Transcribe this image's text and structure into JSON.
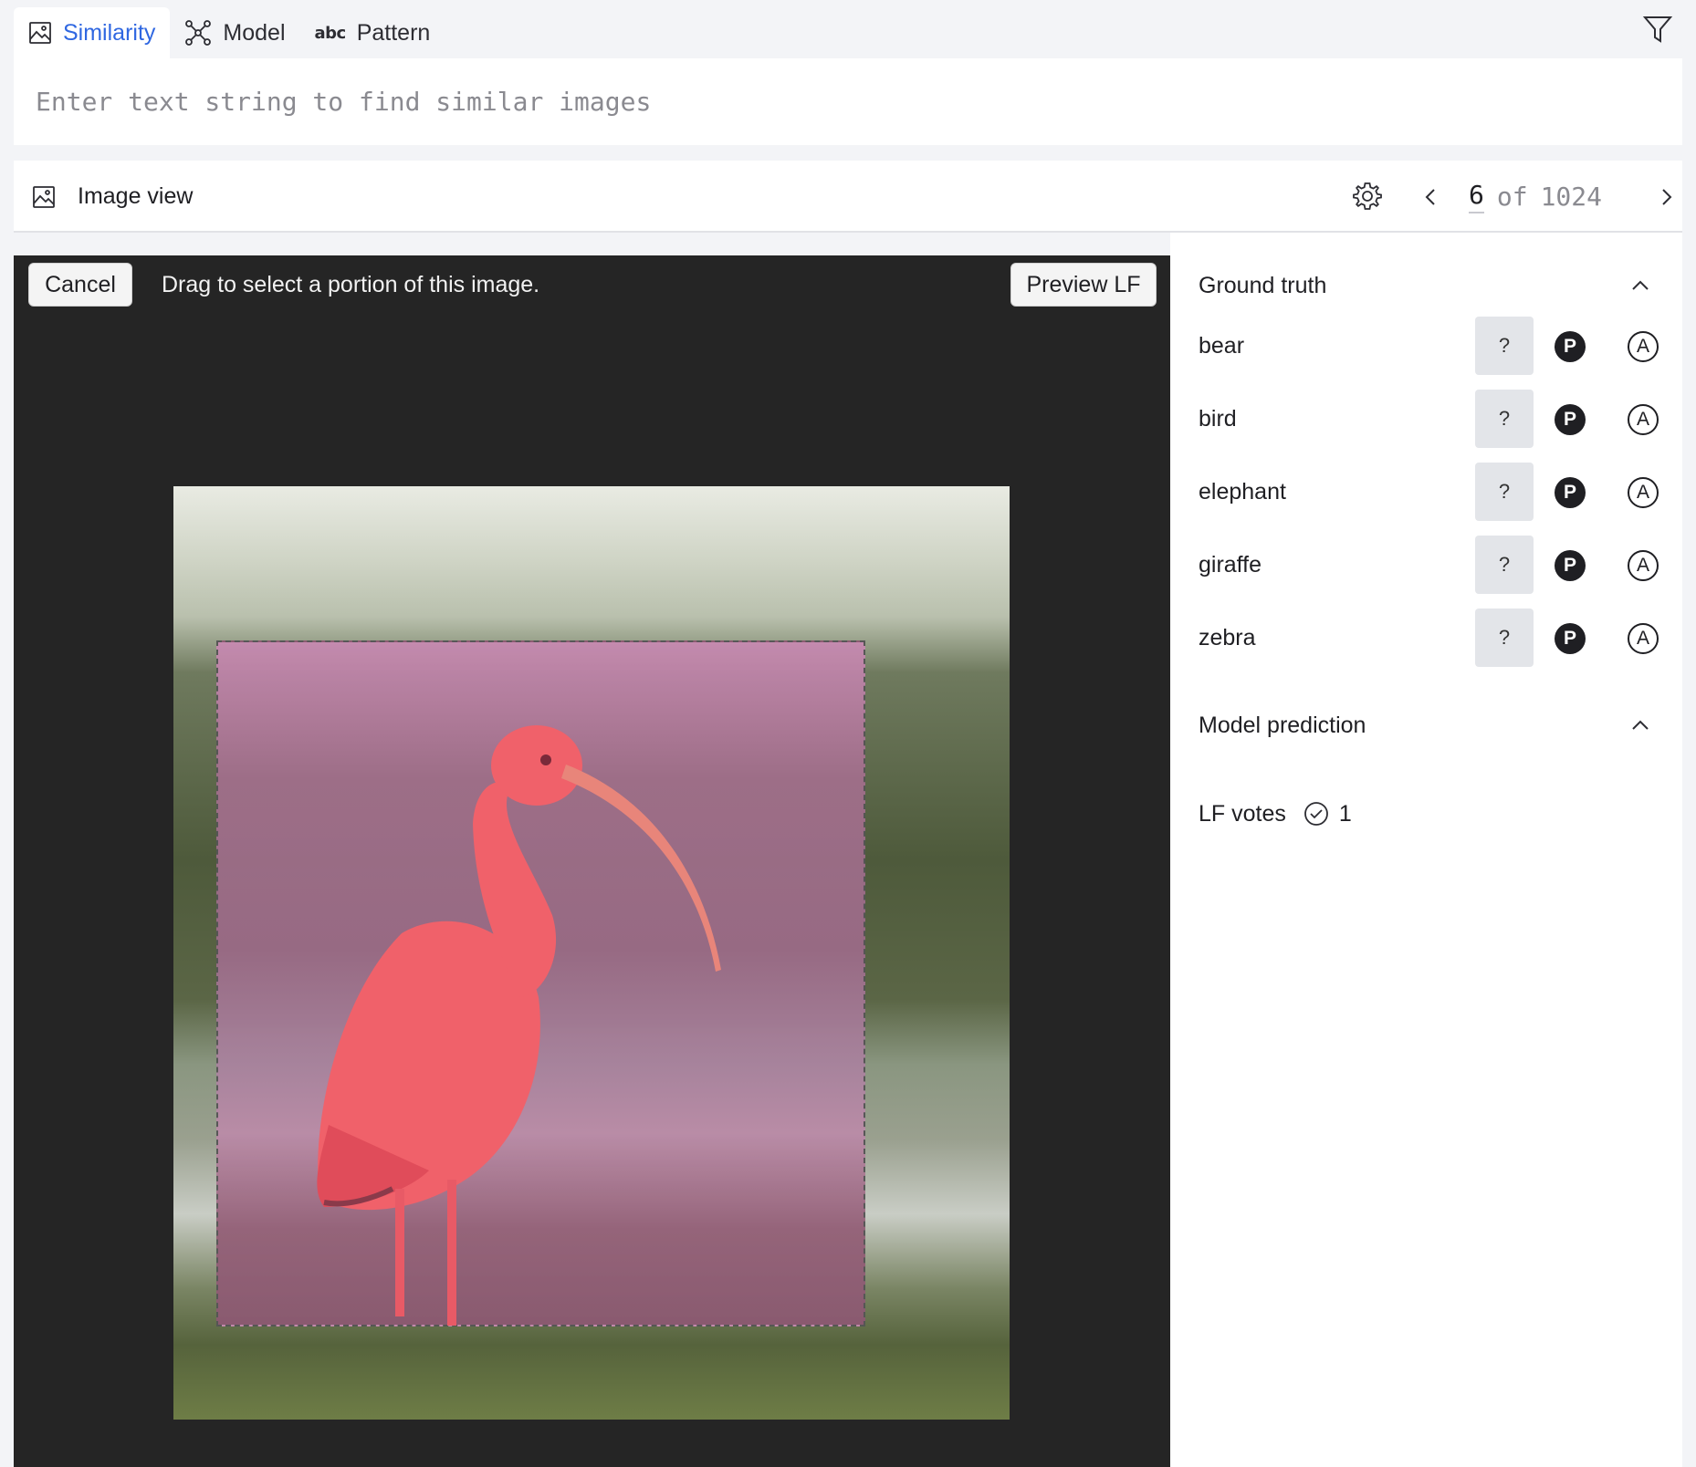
{
  "tabs": [
    {
      "label": "Similarity",
      "icon": "image-icon",
      "active": true
    },
    {
      "label": "Model",
      "icon": "network-icon"
    },
    {
      "label": "Pattern",
      "icon": "abc-icon",
      "glyph": "abc"
    }
  ],
  "search": {
    "placeholder": "Enter text string to find similar images",
    "value": ""
  },
  "image_view": {
    "title": "Image view",
    "current": "6",
    "of_label": "of",
    "total": "1024"
  },
  "panel": {
    "cancel_label": "Cancel",
    "hint": "Drag to select a portion of this image.",
    "preview_label": "Preview LF"
  },
  "ground_truth": {
    "title": "Ground truth",
    "unknown_label": "?",
    "positive_label": "P",
    "abstain_label": "A",
    "labels": [
      "bear",
      "bird",
      "elephant",
      "giraffe",
      "zebra"
    ]
  },
  "model_prediction": {
    "title": "Model prediction"
  },
  "lf_votes": {
    "label": "LF votes",
    "count": "1"
  },
  "colors": {
    "accent": "#2f67e1",
    "panel_bg": "#252525",
    "app_bg": "#f3f4f7"
  }
}
